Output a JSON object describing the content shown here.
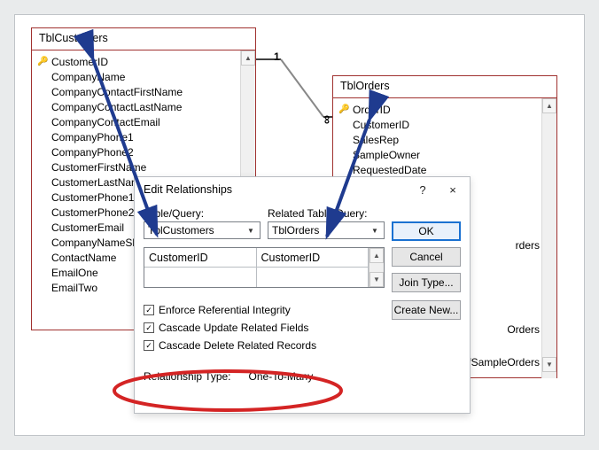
{
  "table_left": {
    "title": "TblCustomers",
    "fields": [
      {
        "name": "CustomerID",
        "key": true
      },
      {
        "name": "CompanyName"
      },
      {
        "name": "CompanyContactFirstName"
      },
      {
        "name": "CompanyContactLastName"
      },
      {
        "name": "CompanyContactEmail"
      },
      {
        "name": "CompanyPhone1"
      },
      {
        "name": "CompanyPhone2"
      },
      {
        "name": "CustomerFirstName"
      },
      {
        "name": "CustomerLastName"
      },
      {
        "name": "CustomerPhone1"
      },
      {
        "name": "CustomerPhone2"
      },
      {
        "name": "CustomerEmail"
      },
      {
        "name": "CompanyNameShip"
      },
      {
        "name": "ContactName"
      },
      {
        "name": "EmailOne"
      },
      {
        "name": "EmailTwo"
      }
    ]
  },
  "table_right": {
    "title": "TblOrders",
    "fields": [
      {
        "name": "OrderID",
        "key": true
      },
      {
        "name": "CustomerID"
      },
      {
        "name": "SalesRep"
      },
      {
        "name": "SampleOwner"
      },
      {
        "name": "RequestedDate"
      }
    ],
    "obscured_lines": [
      "rders",
      "Orders",
      "fSampleOrders"
    ]
  },
  "relationship_line": {
    "one": "1",
    "many": "∞"
  },
  "dialog": {
    "title": "Edit Relationships",
    "help_symbol": "?",
    "close_symbol": "×",
    "labels": {
      "table_query": "Table/Query:",
      "related_table_query": "Related Table/Query:",
      "relationship_type": "Relationship Type:"
    },
    "combos": {
      "table": "TblCustomers",
      "related": "TblOrders"
    },
    "grid": {
      "row0_left": "CustomerID",
      "row0_right": "CustomerID",
      "row1_left": "",
      "row1_right": ""
    },
    "checkboxes": {
      "enforce": {
        "label": "Enforce Referential Integrity",
        "checked": true
      },
      "cascade_update": {
        "label": "Cascade Update Related Fields",
        "checked": true
      },
      "cascade_delete": {
        "label": "Cascade Delete Related Records",
        "checked": true
      }
    },
    "relationship_type_value": "One-To-Many",
    "buttons": {
      "ok": "OK",
      "cancel": "Cancel",
      "join_type": "Join Type...",
      "create_new": "Create New..."
    }
  }
}
